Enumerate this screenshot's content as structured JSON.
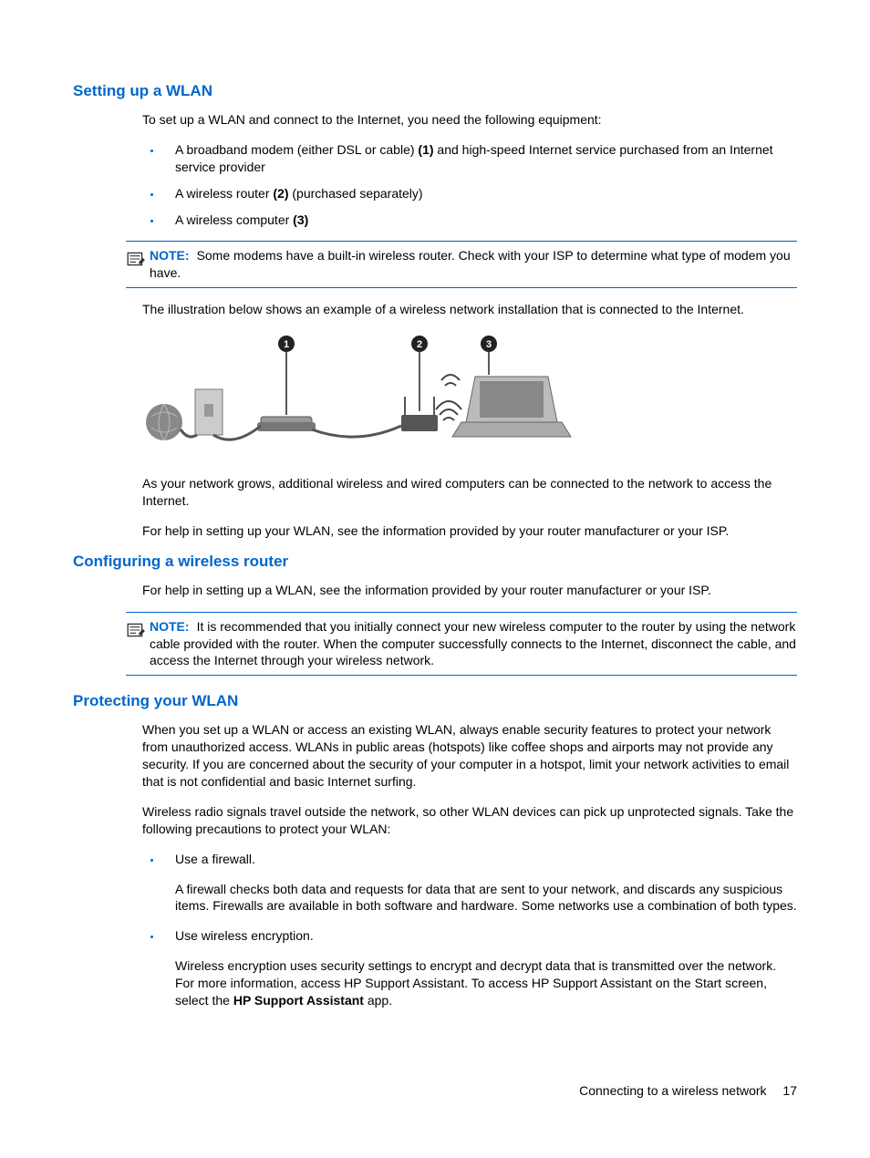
{
  "section1": {
    "heading": "Setting up a WLAN",
    "intro": "To set up a WLAN and connect to the Internet, you need the following equipment:",
    "bullets": [
      {
        "pre": "A broadband modem (either DSL or cable) ",
        "bold": "(1)",
        "post": " and high-speed Internet service purchased from an Internet service provider"
      },
      {
        "pre": "A wireless router ",
        "bold": "(2)",
        "post": " (purchased separately)"
      },
      {
        "pre": "A wireless computer ",
        "bold": "(3)",
        "post": ""
      }
    ],
    "note_label": "NOTE:",
    "note_text": "Some modems have a built-in wireless router. Check with your ISP to determine what type of modem you have.",
    "after_note": "The illustration below shows an example of a wireless network installation that is connected to the Internet.",
    "after_illus1": "As your network grows, additional wireless and wired computers can be connected to the network to access the Internet.",
    "after_illus2": "For help in setting up your WLAN, see the information provided by your router manufacturer or your ISP.",
    "callouts": {
      "c1": "1",
      "c2": "2",
      "c3": "3"
    }
  },
  "section2": {
    "heading": "Configuring a wireless router",
    "intro": "For help in setting up a WLAN, see the information provided by your router manufacturer or your ISP.",
    "note_label": "NOTE:",
    "note_text": "It is recommended that you initially connect your new wireless computer to the router by using the network cable provided with the router. When the computer successfully connects to the Internet, disconnect the cable, and access the Internet through your wireless network."
  },
  "section3": {
    "heading": "Protecting your WLAN",
    "p1": "When you set up a WLAN or access an existing WLAN, always enable security features to protect your network from unauthorized access. WLANs in public areas (hotspots) like coffee shops and airports may not provide any security. If you are concerned about the security of your computer in a hotspot, limit your network activities to email that is not confidential and basic Internet surfing.",
    "p2": "Wireless radio signals travel outside the network, so other WLAN devices can pick up unprotected signals. Take the following precautions to protect your WLAN:",
    "b1_head": "Use a firewall.",
    "b1_body": "A firewall checks both data and requests for data that are sent to your network, and discards any suspicious items. Firewalls are available in both software and hardware. Some networks use a combination of both types.",
    "b2_head": "Use wireless encryption.",
    "b2_body_pre": "Wireless encryption uses security settings to encrypt and decrypt data that is transmitted over the network. For more information, access HP Support Assistant. To access HP Support Assistant on the Start screen, select the ",
    "b2_body_bold": "HP Support Assistant",
    "b2_body_post": " app."
  },
  "footer": {
    "title": "Connecting to a wireless network",
    "page": "17"
  }
}
